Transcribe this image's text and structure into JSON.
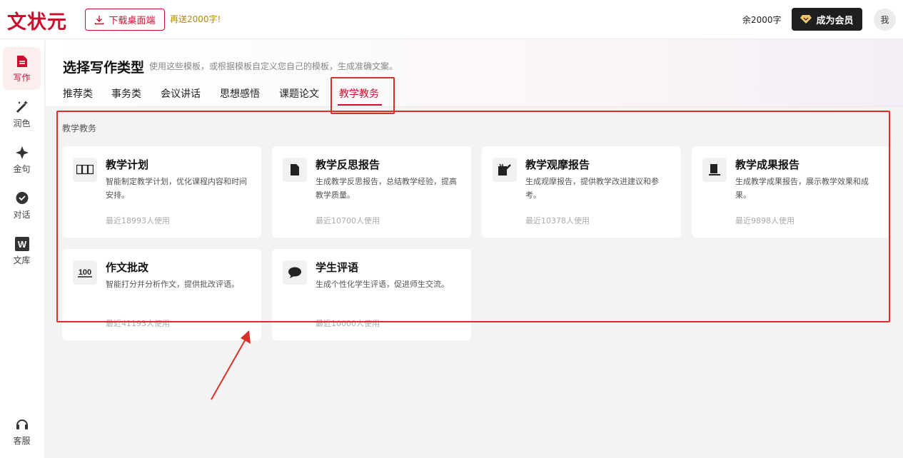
{
  "header": {
    "logo": "文状元",
    "download_label": "下载桌面端",
    "promo": "再送2000字!",
    "remaining": "余2000字",
    "vip_label": "成为会员",
    "avatar": "我"
  },
  "sidebar": {
    "items": [
      {
        "label": "写作",
        "icon": "document-icon",
        "active": true
      },
      {
        "label": "润色",
        "icon": "magic-wand-icon",
        "active": false
      },
      {
        "label": "金句",
        "icon": "sparkle-icon",
        "active": false
      },
      {
        "label": "对话",
        "icon": "chat-icon",
        "active": false
      },
      {
        "label": "文库",
        "icon": "w-library-icon",
        "active": false
      }
    ],
    "support_label": "客服"
  },
  "main": {
    "title": "选择写作类型",
    "subtitle": "使用这些模板，或根据模板自定义您自己的模板，生成准确文案。",
    "tabs": [
      "推荐类",
      "事务类",
      "会议讲话",
      "思想感悟",
      "课题论文",
      "教学教务"
    ],
    "active_tab": "教学教务",
    "section_label": "教学教务",
    "cards": [
      {
        "title": "教学计划",
        "desc": "智能制定教学计划，优化课程内容和时间安排。",
        "usage": "最近18993人使用",
        "icon": "table-icon"
      },
      {
        "title": "教学反思报告",
        "desc": "生成教学反思报告，总结教学经验，提高教学质量。",
        "usage": "最近10700人使用",
        "icon": "file-icon"
      },
      {
        "title": "教学观摩报告",
        "desc": "生成观摩报告，提供教学改进建议和参考。",
        "usage": "最近10378人使用",
        "icon": "edit-icon"
      },
      {
        "title": "教学成果报告",
        "desc": "生成教学成果报告，展示教学效果和成果。",
        "usage": "最近9898人使用",
        "icon": "report-icon"
      },
      {
        "title": "作文批改",
        "desc": "智能打分并分析作文，提供批改评语。",
        "usage": "最近41193人使用",
        "icon": "score-100-icon"
      },
      {
        "title": "学生评语",
        "desc": "生成个性化学生评语，促进师生交流。",
        "usage": "最近10000人使用",
        "icon": "speech-bubble-icon"
      }
    ]
  },
  "colors": {
    "brand": "#c8102e",
    "annotation": "#d9302a"
  }
}
